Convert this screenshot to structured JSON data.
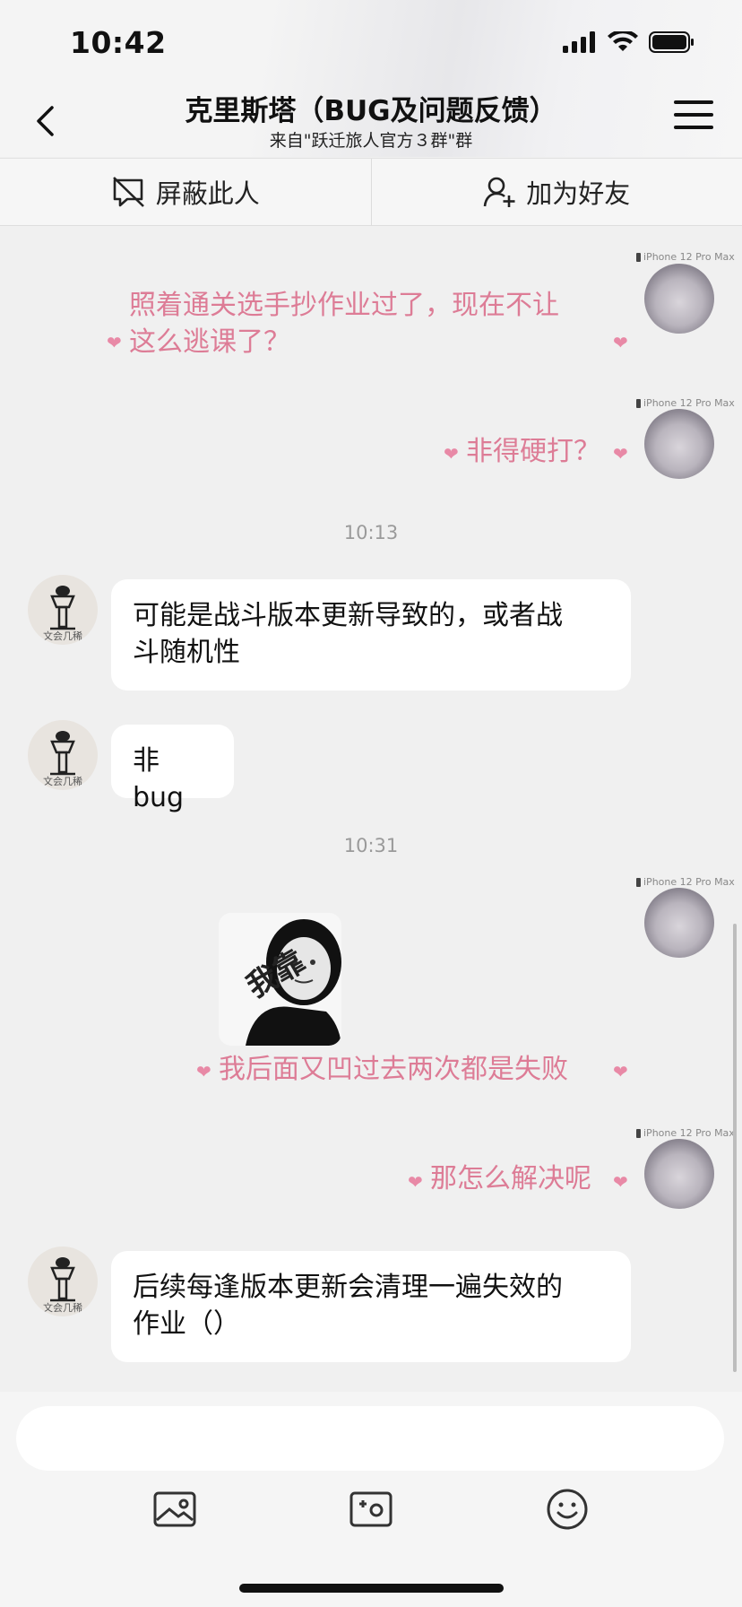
{
  "status_bar": {
    "time": "10:42"
  },
  "header": {
    "title": "克里斯塔（BUG及问题反馈）",
    "subtitle": "来自\"跃迁旅人官方３群\"群"
  },
  "actions": {
    "block_label": "屏蔽此人",
    "add_friend_label": "加为好友"
  },
  "device_tag": "iPhone 12 Pro Max",
  "other_avatar_text": "文会几稀",
  "messages": [
    {
      "side": "right",
      "text_line1": "照着通关选手抄作业过了，现在不让",
      "text_line2": "这么逃课了？"
    },
    {
      "side": "right",
      "text": "非得硬打？"
    },
    {
      "type": "time",
      "text": "10:13"
    },
    {
      "side": "left",
      "text_line1": "可能是战斗版本更新导致的，或者战",
      "text_line2": "斗随机性"
    },
    {
      "side": "left",
      "text": "非 bug"
    },
    {
      "type": "time",
      "text": "10:31"
    },
    {
      "side": "right",
      "sticker_text": "我靠",
      "text": "我后面又凹过去两次都是失败"
    },
    {
      "side": "right",
      "text": "那怎么解决呢"
    },
    {
      "side": "left",
      "text_line1": "后续每逢版本更新会清理一遍失效的",
      "text_line2": "作业（）"
    }
  ],
  "colors": {
    "pink": "#dd7c96",
    "heart": "#e889a6",
    "background": "#f0f0f0"
  }
}
